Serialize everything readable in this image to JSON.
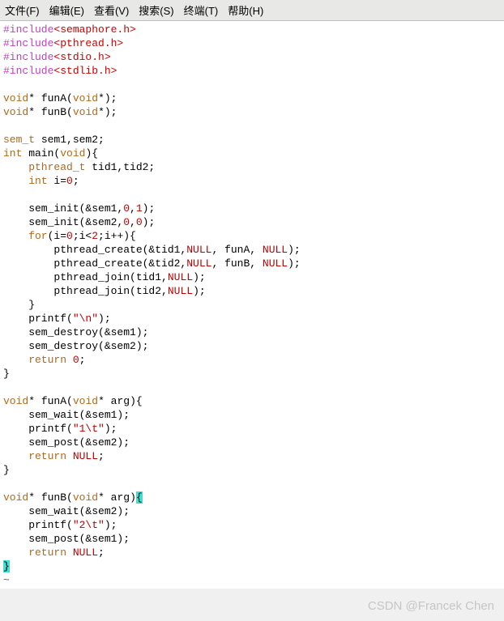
{
  "menubar": {
    "file": "文件(F)",
    "edit": "编辑(E)",
    "view": "查看(V)",
    "search": "搜索(S)",
    "terminal": "终端(T)",
    "help": "帮助(H)"
  },
  "code": {
    "inc": "#include",
    "h1": "<semaphore.h>",
    "h2": "<pthread.h>",
    "h3": "<stdio.h>",
    "h4": "<stdlib.h>",
    "void": "void",
    "star": "*",
    "funA": " funA(",
    "funB": " funB(",
    "declend": ");",
    "semt": "sem_t",
    "semdecl": " sem1,sem2;",
    "int": "int",
    "mainopen": " main(",
    "voidp": "void",
    "closep": "){",
    "closep2": ")",
    "pthreadt": "    pthread_t",
    "tids": " tid1,tid2;",
    "intdecl": "    int",
    "ieq": " i=",
    "zero": "0",
    "semi": ";",
    "seminit1a": "    sem_init(&sem1,",
    "comma": ",",
    "one": "1",
    "seminit2a": "    sem_init(&sem2,",
    "for": "    for",
    "foropen": "(i=",
    "forlt": ";i<",
    "two": "2",
    "forinc": ";i++){",
    "pcreate1a": "        pthread_create(&tid1,",
    "null": "NULL",
    "pcreate1b": ", funA, ",
    "pcreate2a": "        pthread_create(&tid2,",
    "pcreate2b": ", funB, ",
    "pjoin1": "        pthread_join(tid1,",
    "pjoin2": "        pthread_join(tid2,",
    "cbrace4": "    }",
    "printf": "    printf(",
    "strnl": "\"\\n\"",
    "semd1": "    sem_destroy(&sem1);",
    "semd2": "    sem_destroy(&sem2);",
    "return": "    return",
    "sp": " ",
    "cbrace0": "}",
    "funAsig": " funA(",
    "arg": " arg)",
    "obrace": "{",
    "semwait1": "    sem_wait(&sem1);",
    "printf1": "    printf(",
    "str1t": "\"1\\t\"",
    "sempost2": "    sem_post(&sem2);",
    "retnull": "    return",
    "funBsig": " funB(",
    "semwait2": "    sem_wait(&sem2);",
    "printf2": "    printf(",
    "str2t": "\"2\\t\"",
    "sempost1": "    sem_post(&sem1);",
    "tilde": "~"
  },
  "watermark": "CSDN @Francek Chen"
}
